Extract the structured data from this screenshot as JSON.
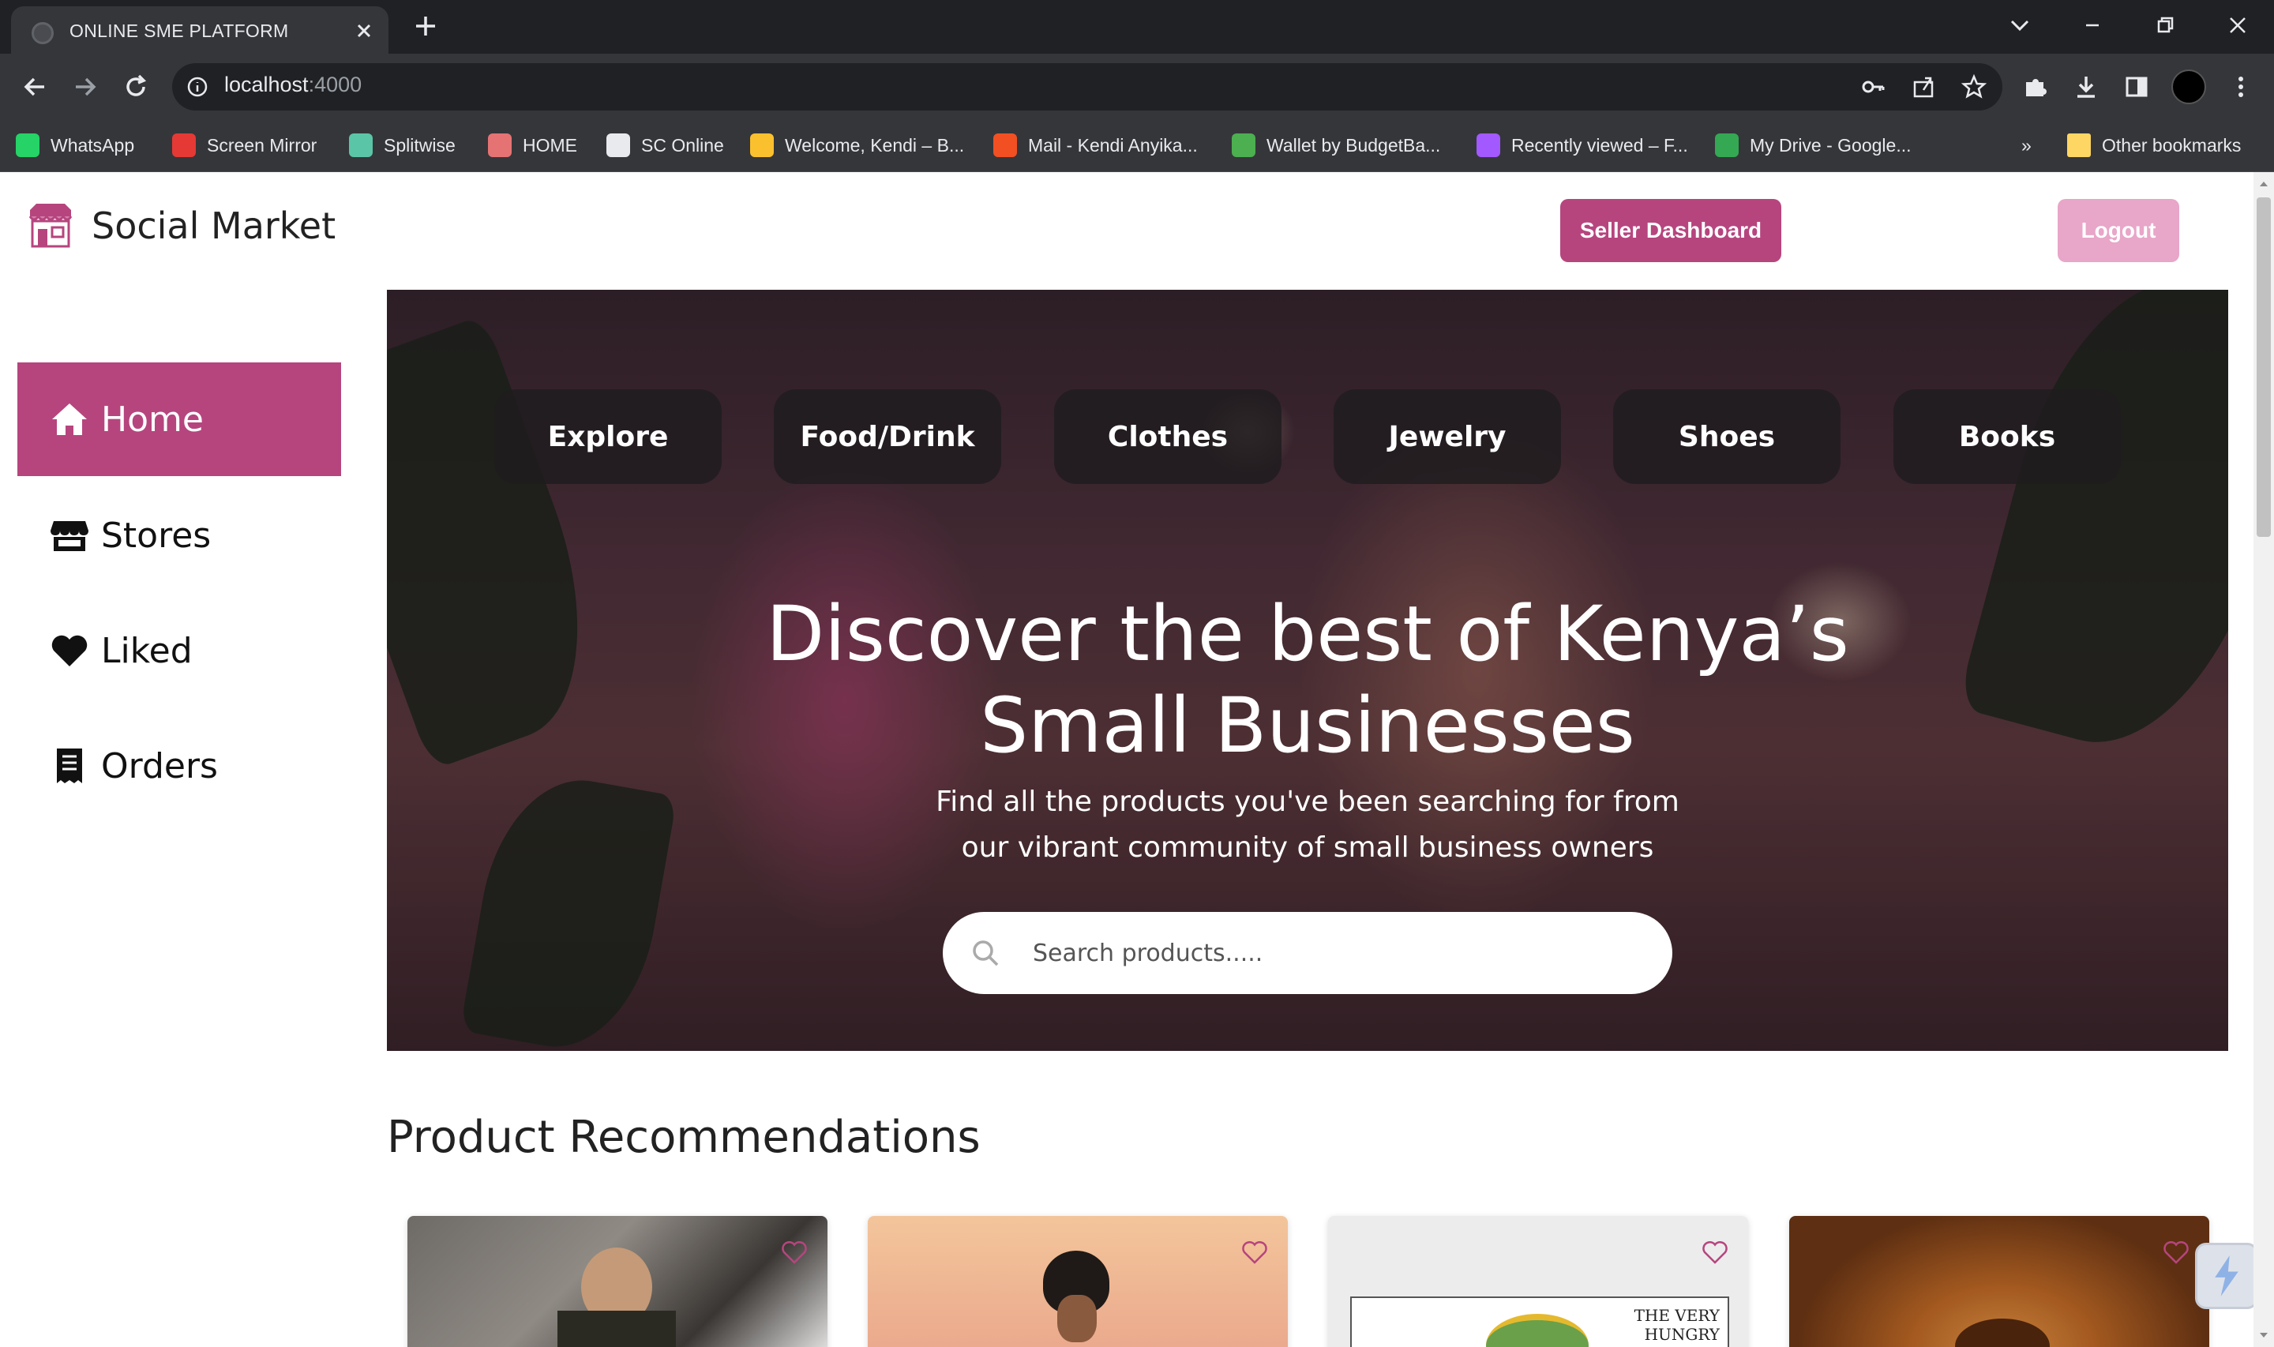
{
  "browser": {
    "tab_title": "ONLINE SME PLATFORM",
    "url_host": "localhost",
    "url_port": ":4000",
    "bookmarks": [
      {
        "label": "WhatsApp",
        "icon": "whatsapp-icon",
        "color": "#25d366"
      },
      {
        "label": "Screen Mirror",
        "icon": "screen-mirror-icon",
        "color": "#e53935"
      },
      {
        "label": "Splitwise",
        "icon": "splitwise-icon",
        "color": "#5bc5a7"
      },
      {
        "label": "HOME",
        "icon": "home-bookmark-icon",
        "color": "#e57373"
      },
      {
        "label": "SC Online",
        "icon": "globe-icon",
        "color": "#e8eaed"
      },
      {
        "label": "Welcome, Kendi – B...",
        "icon": "bar-chart-icon",
        "color": "#fbc02d"
      },
      {
        "label": "Mail - Kendi Anyika...",
        "icon": "microsoft-icon",
        "color": "#f25022"
      },
      {
        "label": "Wallet by BudgetBa...",
        "icon": "wallet-icon",
        "color": "#4caf50"
      },
      {
        "label": "Recently viewed – F...",
        "icon": "figma-icon",
        "color": "#a259ff"
      },
      {
        "label": "My Drive - Google...",
        "icon": "google-drive-icon",
        "color": "#34a853"
      }
    ],
    "other_bookmarks": "Other bookmarks",
    "overflow": "»"
  },
  "header": {
    "brand": "Social Market",
    "seller_dashboard": "Seller Dashboard",
    "logout": "Logout"
  },
  "sidebar": {
    "items": [
      {
        "label": "Home",
        "icon": "home-icon",
        "active": true
      },
      {
        "label": "Stores",
        "icon": "store-icon",
        "active": false
      },
      {
        "label": "Liked",
        "icon": "heart-icon",
        "active": false
      },
      {
        "label": "Orders",
        "icon": "receipt-icon",
        "active": false
      }
    ]
  },
  "hero": {
    "categories": [
      "Explore",
      "Food/Drink",
      "Clothes",
      "Jewelry",
      "Shoes",
      "Books"
    ],
    "title_line1": "Discover the best of Kenya’s",
    "title_line2": "Small Businesses",
    "subtitle": "Find all the products you've been searching for from our vibrant community of small business owners",
    "search_placeholder": "Search products....."
  },
  "recommendations": {
    "title": "Product Recommendations",
    "cards": [
      {
        "image": "woman-in-sequined-top",
        "liked": false
      },
      {
        "image": "woman-with-headwrap",
        "liked": false
      },
      {
        "image": "book-cover",
        "cover_text": "THE VERY HUNGRY",
        "liked": false
      },
      {
        "image": "glazed-donut",
        "liked": false
      }
    ]
  },
  "colors": {
    "accent": "#b6457e",
    "accent_light": "#e8a6c8"
  }
}
